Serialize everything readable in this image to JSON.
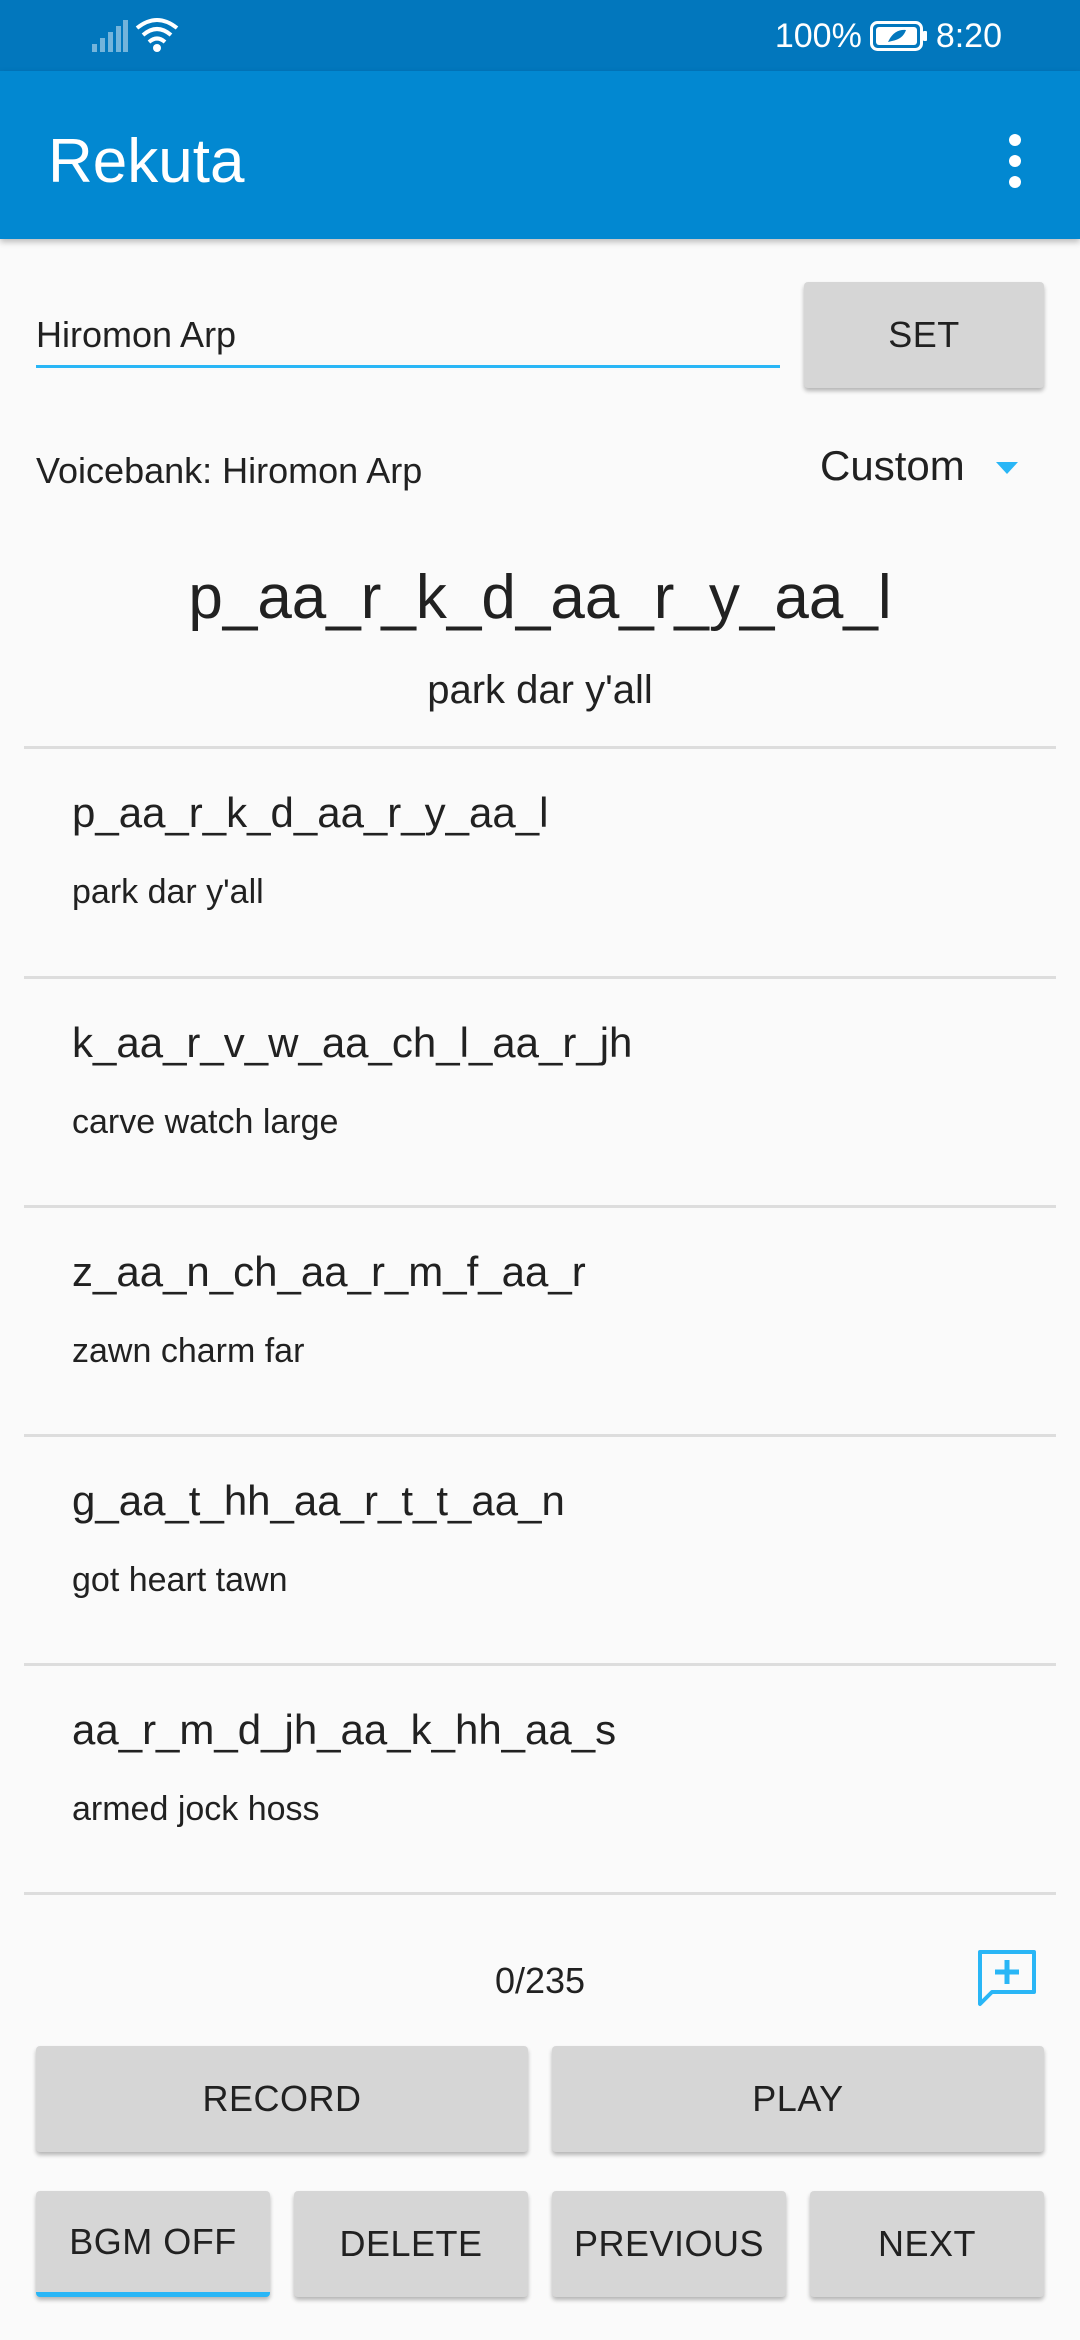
{
  "status_bar": {
    "battery": "100%",
    "time": "8:20"
  },
  "app_bar": {
    "title": "Rekuta"
  },
  "voicebank_input": {
    "value": "Hiromon Arp"
  },
  "set_button": {
    "label": "SET"
  },
  "voicebank_label": "Voicebank: Hiromon Arp",
  "preset_dropdown": {
    "selected": "Custom"
  },
  "current": {
    "phonemes": "p_aa_r_k_d_aa_r_y_aa_l",
    "words": "park dar y'all"
  },
  "list": [
    {
      "phonemes": "p_aa_r_k_d_aa_r_y_aa_l",
      "words": "park dar y'all"
    },
    {
      "phonemes": "k_aa_r_v_w_aa_ch_l_aa_r_jh",
      "words": "carve watch large"
    },
    {
      "phonemes": "z_aa_n_ch_aa_r_m_f_aa_r",
      "words": "zawn charm far"
    },
    {
      "phonemes": "g_aa_t_hh_aa_r_t_t_aa_n",
      "words": "got heart tawn"
    },
    {
      "phonemes": "aa_r_m_d_jh_aa_k_hh_aa_s",
      "words": "armed jock hoss"
    }
  ],
  "counter": "0/235",
  "buttons": {
    "record": "RECORD",
    "play": "PLAY",
    "bgm": "BGM OFF",
    "delete": "DELETE",
    "previous": "PREVIOUS",
    "next": "NEXT"
  },
  "icons": {
    "status": [
      "signal-icon",
      "wifi-icon",
      "battery-icon"
    ],
    "appbar": "more-vert-icon",
    "add": "add-comment-icon",
    "dropdown": "dropdown-arrow-icon"
  },
  "colors": {
    "status_bar": "#0277bd",
    "app_bar": "#0288d1",
    "accent": "#29b6f6",
    "button": "#d6d6d6",
    "background": "#fafafa"
  }
}
